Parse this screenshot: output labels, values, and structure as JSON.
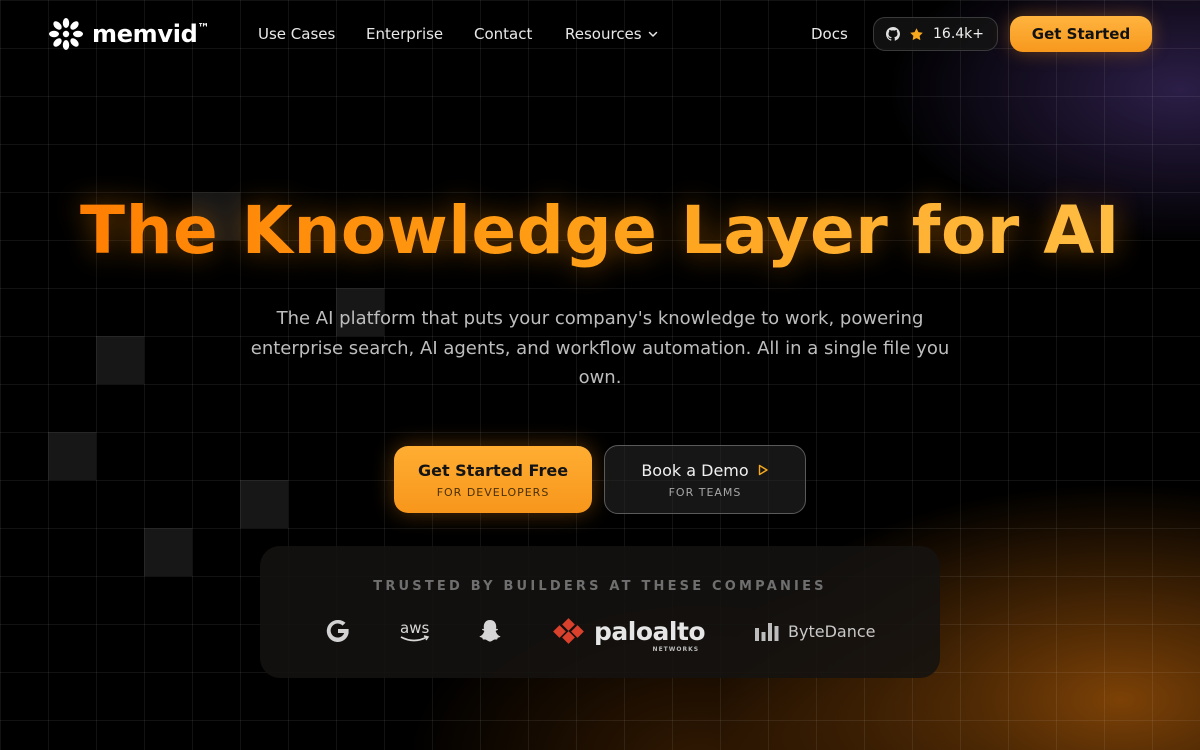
{
  "brand": {
    "name": "memvid",
    "trademark": "™",
    "logo_icon": "memvid-flower-logo"
  },
  "nav": {
    "links": [
      "Use Cases",
      "Enterprise",
      "Contact"
    ],
    "resources_label": "Resources",
    "docs_label": "Docs",
    "github_stars": "16.4k+",
    "cta_label": "Get Started"
  },
  "hero": {
    "title": "The Knowledge Layer for AI",
    "subtitle": "The AI platform that puts your company's knowledge to work, powering enterprise search, AI agents, and workflow automation. All in a single file you own."
  },
  "actions": {
    "primary": {
      "label": "Get Started Free",
      "sublabel": "FOR DEVELOPERS"
    },
    "secondary": {
      "label": "Book a Demo",
      "sublabel": "FOR TEAMS"
    }
  },
  "trusted": {
    "label": "TRUSTED BY BUILDERS AT THESE COMPANIES",
    "companies": {
      "google": "google-logo",
      "aws": "aws",
      "snapchat": "snapchat-ghost-logo",
      "paloalto": {
        "name": "paloalto",
        "sub": "NETWORKS"
      },
      "bytedance": "ByteDance"
    }
  },
  "colors": {
    "accent": "#f7981d",
    "accent_light": "#ffb43f",
    "title_gradient_start": "#ff7a00",
    "title_gradient_end": "#ffc24a",
    "background": "#000000",
    "palo_red": "#d9412c"
  }
}
